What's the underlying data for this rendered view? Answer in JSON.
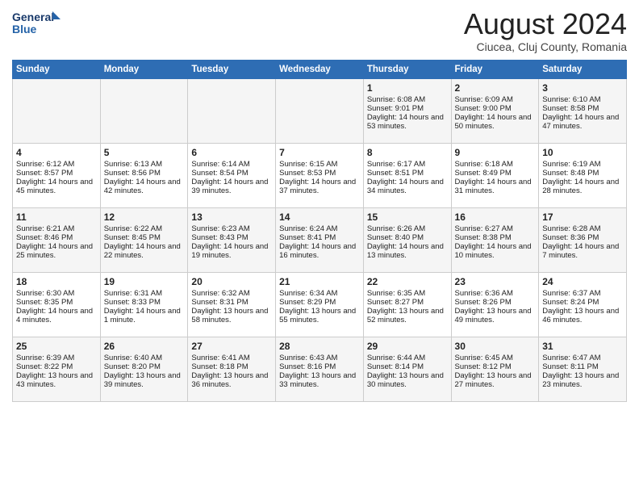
{
  "logo": {
    "line1": "General",
    "line2": "Blue"
  },
  "title": "August 2024",
  "subtitle": "Ciucea, Cluj County, Romania",
  "days_of_week": [
    "Sunday",
    "Monday",
    "Tuesday",
    "Wednesday",
    "Thursday",
    "Friday",
    "Saturday"
  ],
  "weeks": [
    [
      {
        "day": "",
        "info": ""
      },
      {
        "day": "",
        "info": ""
      },
      {
        "day": "",
        "info": ""
      },
      {
        "day": "",
        "info": ""
      },
      {
        "day": "1",
        "info": "Sunrise: 6:08 AM\nSunset: 9:01 PM\nDaylight: 14 hours and 53 minutes."
      },
      {
        "day": "2",
        "info": "Sunrise: 6:09 AM\nSunset: 9:00 PM\nDaylight: 14 hours and 50 minutes."
      },
      {
        "day": "3",
        "info": "Sunrise: 6:10 AM\nSunset: 8:58 PM\nDaylight: 14 hours and 47 minutes."
      }
    ],
    [
      {
        "day": "4",
        "info": "Sunrise: 6:12 AM\nSunset: 8:57 PM\nDaylight: 14 hours and 45 minutes."
      },
      {
        "day": "5",
        "info": "Sunrise: 6:13 AM\nSunset: 8:56 PM\nDaylight: 14 hours and 42 minutes."
      },
      {
        "day": "6",
        "info": "Sunrise: 6:14 AM\nSunset: 8:54 PM\nDaylight: 14 hours and 39 minutes."
      },
      {
        "day": "7",
        "info": "Sunrise: 6:15 AM\nSunset: 8:53 PM\nDaylight: 14 hours and 37 minutes."
      },
      {
        "day": "8",
        "info": "Sunrise: 6:17 AM\nSunset: 8:51 PM\nDaylight: 14 hours and 34 minutes."
      },
      {
        "day": "9",
        "info": "Sunrise: 6:18 AM\nSunset: 8:49 PM\nDaylight: 14 hours and 31 minutes."
      },
      {
        "day": "10",
        "info": "Sunrise: 6:19 AM\nSunset: 8:48 PM\nDaylight: 14 hours and 28 minutes."
      }
    ],
    [
      {
        "day": "11",
        "info": "Sunrise: 6:21 AM\nSunset: 8:46 PM\nDaylight: 14 hours and 25 minutes."
      },
      {
        "day": "12",
        "info": "Sunrise: 6:22 AM\nSunset: 8:45 PM\nDaylight: 14 hours and 22 minutes."
      },
      {
        "day": "13",
        "info": "Sunrise: 6:23 AM\nSunset: 8:43 PM\nDaylight: 14 hours and 19 minutes."
      },
      {
        "day": "14",
        "info": "Sunrise: 6:24 AM\nSunset: 8:41 PM\nDaylight: 14 hours and 16 minutes."
      },
      {
        "day": "15",
        "info": "Sunrise: 6:26 AM\nSunset: 8:40 PM\nDaylight: 14 hours and 13 minutes."
      },
      {
        "day": "16",
        "info": "Sunrise: 6:27 AM\nSunset: 8:38 PM\nDaylight: 14 hours and 10 minutes."
      },
      {
        "day": "17",
        "info": "Sunrise: 6:28 AM\nSunset: 8:36 PM\nDaylight: 14 hours and 7 minutes."
      }
    ],
    [
      {
        "day": "18",
        "info": "Sunrise: 6:30 AM\nSunset: 8:35 PM\nDaylight: 14 hours and 4 minutes."
      },
      {
        "day": "19",
        "info": "Sunrise: 6:31 AM\nSunset: 8:33 PM\nDaylight: 14 hours and 1 minute."
      },
      {
        "day": "20",
        "info": "Sunrise: 6:32 AM\nSunset: 8:31 PM\nDaylight: 13 hours and 58 minutes."
      },
      {
        "day": "21",
        "info": "Sunrise: 6:34 AM\nSunset: 8:29 PM\nDaylight: 13 hours and 55 minutes."
      },
      {
        "day": "22",
        "info": "Sunrise: 6:35 AM\nSunset: 8:27 PM\nDaylight: 13 hours and 52 minutes."
      },
      {
        "day": "23",
        "info": "Sunrise: 6:36 AM\nSunset: 8:26 PM\nDaylight: 13 hours and 49 minutes."
      },
      {
        "day": "24",
        "info": "Sunrise: 6:37 AM\nSunset: 8:24 PM\nDaylight: 13 hours and 46 minutes."
      }
    ],
    [
      {
        "day": "25",
        "info": "Sunrise: 6:39 AM\nSunset: 8:22 PM\nDaylight: 13 hours and 43 minutes."
      },
      {
        "day": "26",
        "info": "Sunrise: 6:40 AM\nSunset: 8:20 PM\nDaylight: 13 hours and 39 minutes."
      },
      {
        "day": "27",
        "info": "Sunrise: 6:41 AM\nSunset: 8:18 PM\nDaylight: 13 hours and 36 minutes."
      },
      {
        "day": "28",
        "info": "Sunrise: 6:43 AM\nSunset: 8:16 PM\nDaylight: 13 hours and 33 minutes."
      },
      {
        "day": "29",
        "info": "Sunrise: 6:44 AM\nSunset: 8:14 PM\nDaylight: 13 hours and 30 minutes."
      },
      {
        "day": "30",
        "info": "Sunrise: 6:45 AM\nSunset: 8:12 PM\nDaylight: 13 hours and 27 minutes."
      },
      {
        "day": "31",
        "info": "Sunrise: 6:47 AM\nSunset: 8:11 PM\nDaylight: 13 hours and 23 minutes."
      }
    ]
  ]
}
